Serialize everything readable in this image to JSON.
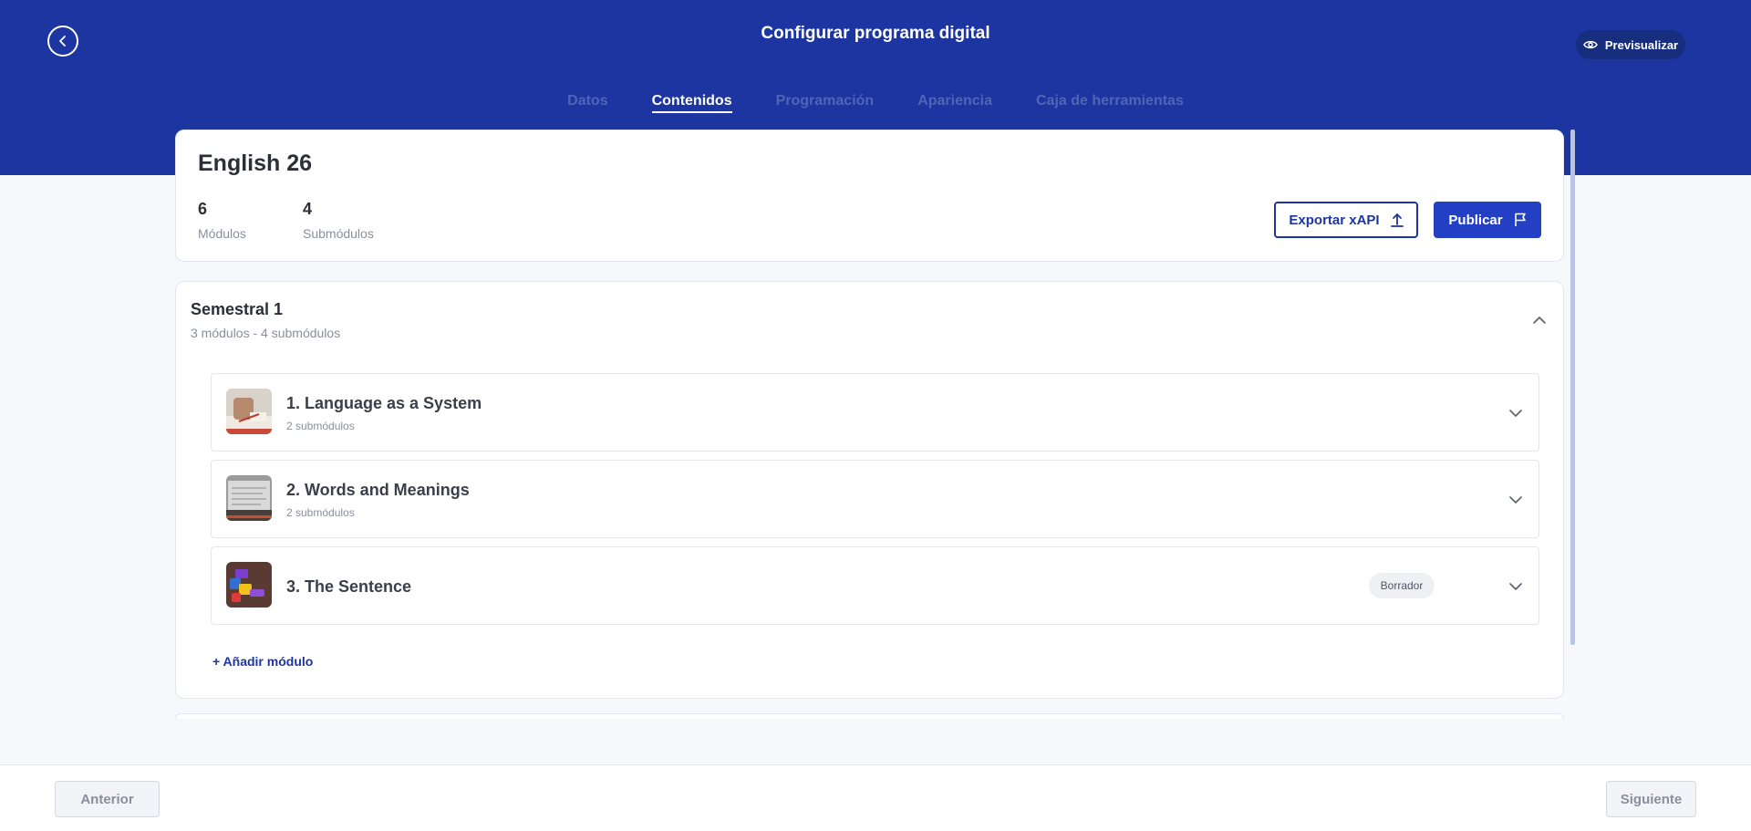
{
  "header": {
    "title": "Configurar programa digital",
    "preview_label": "Previsualizar",
    "tabs": [
      {
        "label": "Datos",
        "active": false
      },
      {
        "label": "Contenidos",
        "active": true
      },
      {
        "label": "Programación",
        "active": false
      },
      {
        "label": "Apariencia",
        "active": false
      },
      {
        "label": "Caja de herramientas",
        "active": false
      }
    ]
  },
  "summary": {
    "program_name": "English 26",
    "stats": [
      {
        "value": "6",
        "label": "Módulos"
      },
      {
        "value": "4",
        "label": "Submódulos"
      }
    ],
    "export_label": "Exportar xAPI",
    "publish_label": "Publicar"
  },
  "section": {
    "title": "Semestral 1",
    "subtitle": "3 módulos - 4 submódulos",
    "modules": [
      {
        "title": "1. Language as a System",
        "subtitle": "2 submódulos",
        "badge": ""
      },
      {
        "title": "2. Words and Meanings",
        "subtitle": "2 submódulos",
        "badge": ""
      },
      {
        "title": "3. The Sentence",
        "subtitle": "",
        "badge": "Borrador"
      }
    ],
    "add_module_label": "+ Añadir módulo"
  },
  "footer": {
    "prev_label": "Anterior",
    "next_label": "Siguiente"
  },
  "colors": {
    "header_bg": "#1d35a1",
    "primary": "#2340c4",
    "page_bg": "#f6f8fc"
  },
  "icons": {
    "back": "chevron-left-icon",
    "preview": "eye-icon",
    "export": "upload-icon",
    "publish": "flag-icon",
    "collapse": "chevron-up-icon",
    "expand": "chevron-down-icon"
  }
}
